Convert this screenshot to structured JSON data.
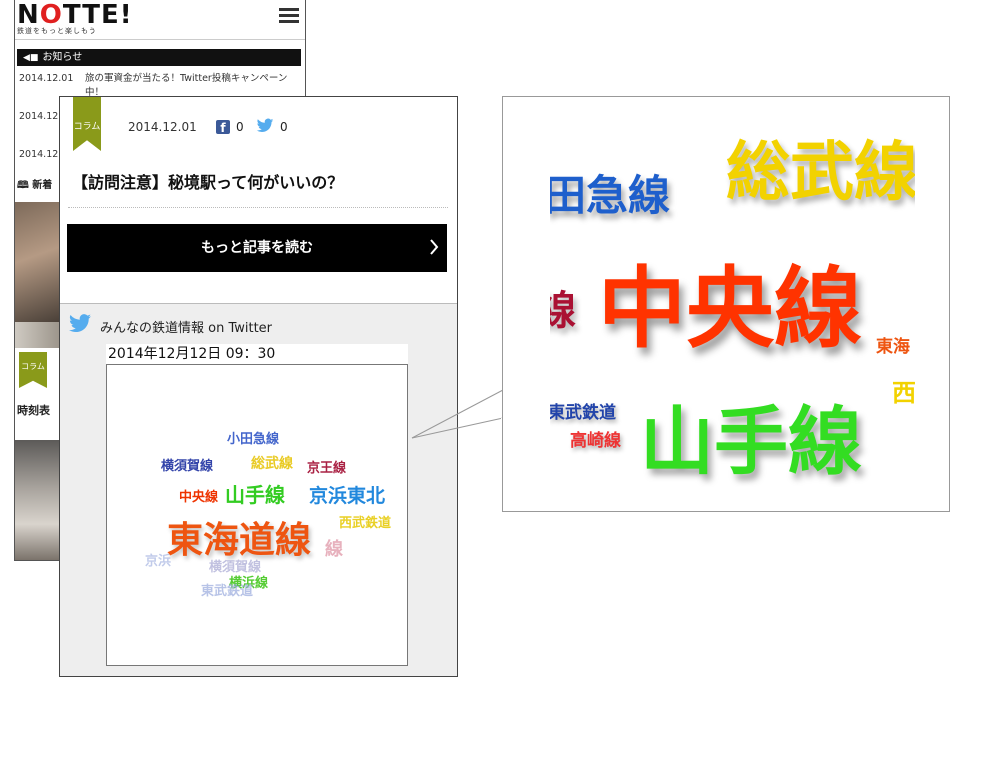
{
  "site": {
    "logo_text": "NOTTE!",
    "tagline": "鉄道をもっと楽しもう",
    "notice_label": "お知らせ",
    "news": [
      {
        "date": "2014.12.01",
        "text": "旅の軍資金が当たる！Twitter投稿キャンペーン中！"
      },
      {
        "date": "2014.12.",
        "text": ""
      },
      {
        "date": "2014.12.",
        "text": ""
      }
    ],
    "new_books_label": "新着",
    "category_label": "コラム",
    "timetable_label": "時刻表"
  },
  "article": {
    "category": "コラム",
    "date": "2014.12.01",
    "facebook_count": "0",
    "twitter_count": "0",
    "title": "【訪問注意】秘境駅って何がいいの？",
    "more_button": "もっと記事を読む"
  },
  "twitter_section": {
    "title": "みんなの鉄道情報 on Twitter",
    "timestamp": "2014年12月12日 09：30"
  },
  "word_cloud": [
    {
      "text": "小田急線",
      "color": "#4466cc"
    },
    {
      "text": "横須賀線",
      "color": "#3344aa"
    },
    {
      "text": "総武線",
      "color": "#e6c200"
    },
    {
      "text": "京王線",
      "color": "#aa2244"
    },
    {
      "text": "中央線",
      "color": "#ee3300"
    },
    {
      "text": "山手線",
      "color": "#33cc22"
    },
    {
      "text": "京浜東北",
      "color": "#2288dd"
    },
    {
      "text": "西武鉄道",
      "color": "#e6c800"
    },
    {
      "text": "東海道線",
      "color": "#ee5511"
    },
    {
      "text": "線",
      "color": "#bb2244"
    },
    {
      "text": "京浜",
      "color": "#99aadd"
    },
    {
      "text": "横須賀線",
      "color": "#9999cc"
    },
    {
      "text": "横浜線",
      "color": "#55cc33"
    },
    {
      "text": "東武鉄道",
      "color": "#99aadd"
    }
  ],
  "zoom_cloud": [
    {
      "text": "田急線",
      "color": "#1e5fcc"
    },
    {
      "text": "総武線",
      "color": "#f2d200"
    },
    {
      "text": "線",
      "color": "#aa1133"
    },
    {
      "text": "中央線",
      "color": "#ff3300"
    },
    {
      "text": "東海",
      "color": "#ee5511"
    },
    {
      "text": "西",
      "color": "#f2d200"
    },
    {
      "text": "東武鉄道",
      "color": "#2244aa"
    },
    {
      "text": "高崎線",
      "color": "#ee3333"
    },
    {
      "text": "山手線",
      "color": "#33dd22"
    }
  ]
}
